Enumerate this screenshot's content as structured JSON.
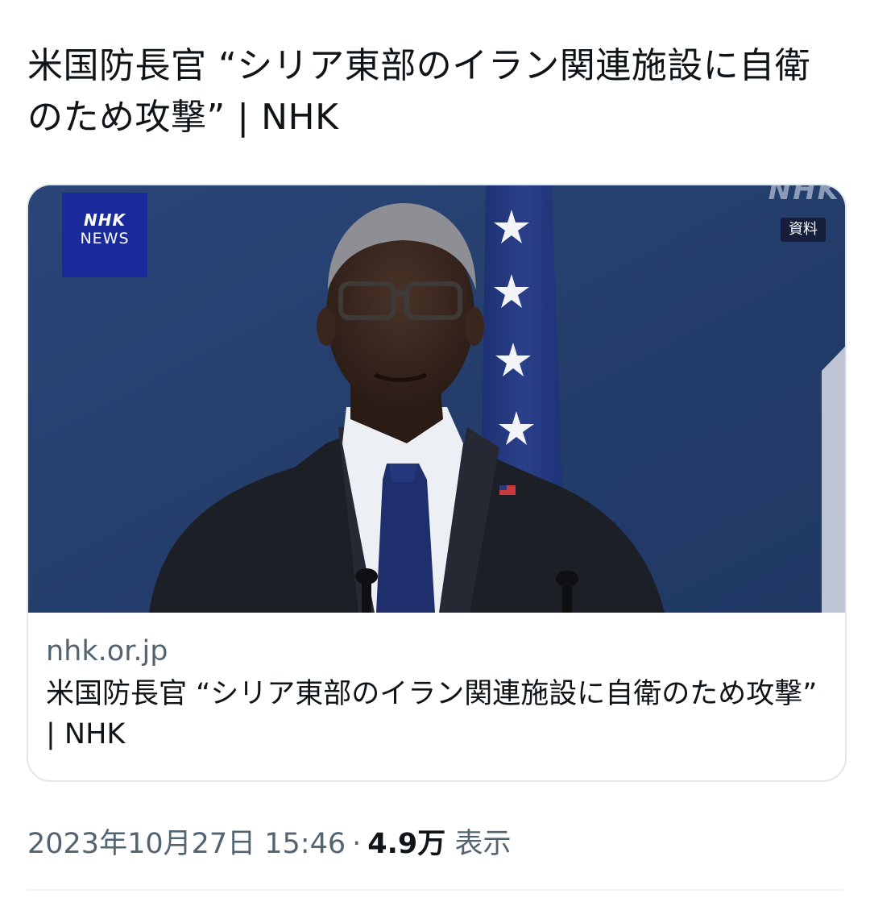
{
  "tweet": {
    "text": "米国防長官 “シリア東部のイラン関連施設に自衛のため攻撃” | NHK"
  },
  "card": {
    "image": {
      "badge_line1": "NHK",
      "badge_line2": "NEWS",
      "watermark": "NHK",
      "tag": "資料"
    },
    "domain": "nhk.or.jp",
    "title": "米国防長官 “シリア東部のイラン関連施設に自衛のため攻撃” | NHK"
  },
  "meta": {
    "timestamp": "2023年10月27日 15:46",
    "separator": "·",
    "views_count": "4.9万",
    "views_label": "表示"
  },
  "colors": {
    "text_primary": "#0f1419",
    "text_secondary": "#536471",
    "card_border": "#e3e7ea",
    "nhk_badge_blue": "#1a2a9a",
    "backdrop_blue": "#2a4575"
  }
}
